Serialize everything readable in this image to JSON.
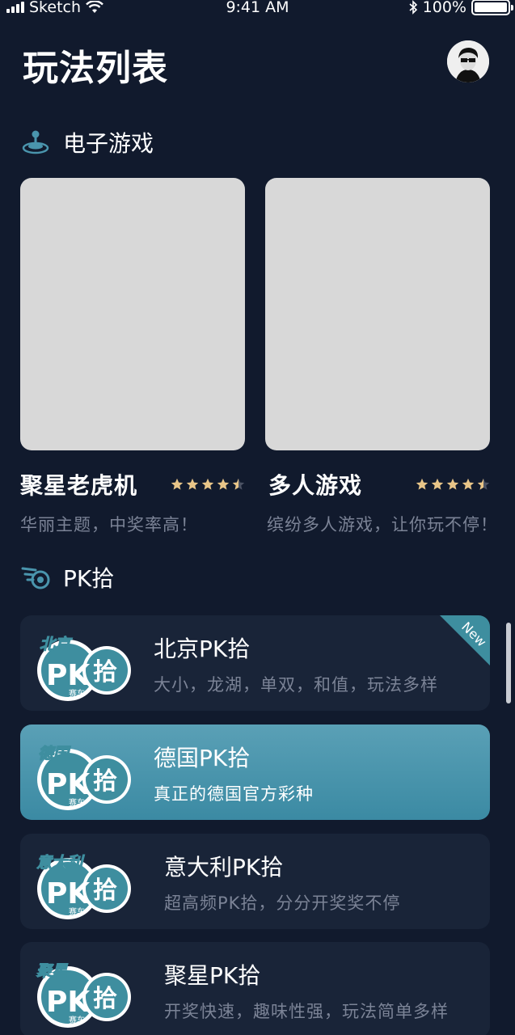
{
  "status_bar": {
    "carrier": "Sketch",
    "time": "9:41 AM",
    "battery": "100%"
  },
  "header": {
    "title": "玩法列表"
  },
  "sections": {
    "egames": {
      "label": "电子游戏"
    },
    "pk": {
      "label": "PK拾"
    }
  },
  "games": [
    {
      "name": "聚星老虎机",
      "desc": "华丽主题，中奖率高！",
      "rating": 4.5
    },
    {
      "name": "多人游戏",
      "desc": "缤纷多人游戏，让你玩不停！",
      "rating": 4.5
    }
  ],
  "pk_items": [
    {
      "logo_tag": "北京",
      "logo_main": "PK",
      "logo_pick": "拾",
      "logo_sub": "赛车",
      "title": "北京PK拾",
      "desc": "大小，龙湖，单双，和值，玩法多样",
      "badge": "New"
    },
    {
      "logo_tag": "德国",
      "logo_main": "PK",
      "logo_pick": "拾",
      "logo_sub": "赛车",
      "title": "德国PK拾",
      "desc": "真正的德国官方彩种"
    },
    {
      "logo_tag": "意大利",
      "logo_main": "PK",
      "logo_pick": "拾",
      "logo_sub": "赛车",
      "title": "意大利PK拾",
      "desc": "超高频PK拾，分分开奖奖不停"
    },
    {
      "logo_tag": "聚星",
      "logo_main": "PK",
      "logo_pick": "拾",
      "logo_sub": "赛车",
      "title": "聚星PK拾",
      "desc": "开奖快速，趣味性强，玩法简单多样"
    }
  ],
  "colors": {
    "background": "#111a2d",
    "card": "#192438",
    "active_card": "#4a95ad",
    "accent_teal": "#3e8e9f",
    "star": "#e8c588",
    "muted_text": "#7b8396"
  },
  "icons": {
    "egames": "joystick-icon",
    "pk": "racing-wheel-icon"
  }
}
